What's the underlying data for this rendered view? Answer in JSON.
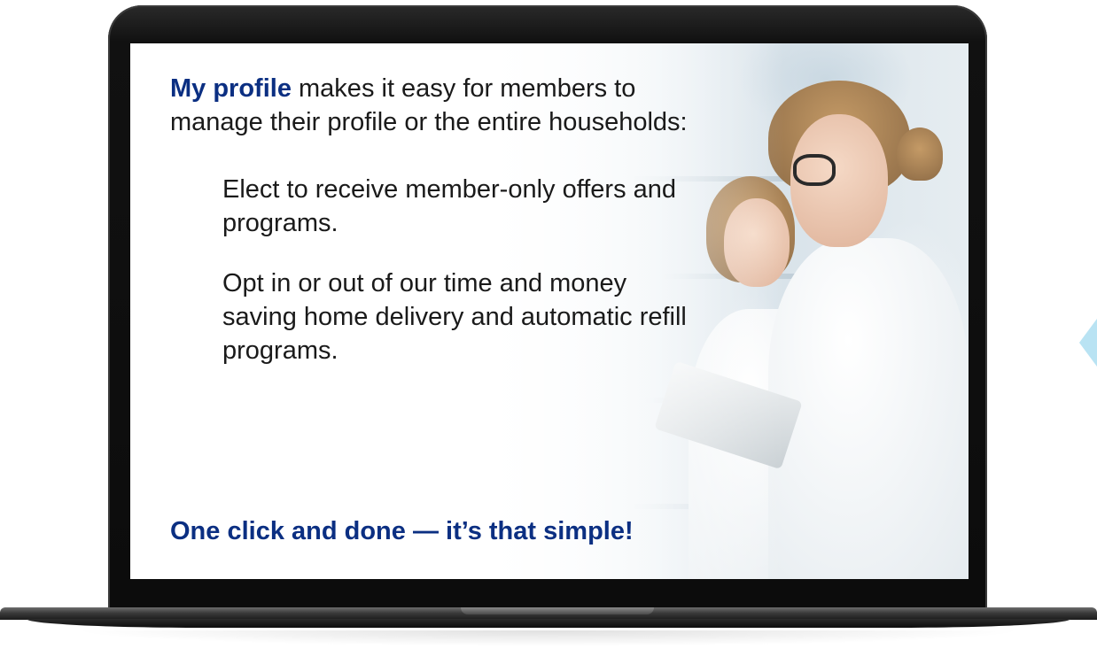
{
  "slide": {
    "intro_lead": "My profile",
    "intro_rest": " makes it easy for members to manage their profile or the entire households:",
    "bullets": [
      "Elect to receive member-only offers and programs.",
      "Opt in or out of our time and money saving home delivery and automatic refill programs."
    ],
    "closing": "One click and done — it’s that simple!"
  },
  "colors": {
    "brand_blue": "#0b2f82",
    "body_text": "#1a1a1a",
    "accent_light_blue": "#b9e3f3",
    "laptop_bezel": "#0c0c0c"
  },
  "image": {
    "subject": "pharmacists-photo"
  }
}
